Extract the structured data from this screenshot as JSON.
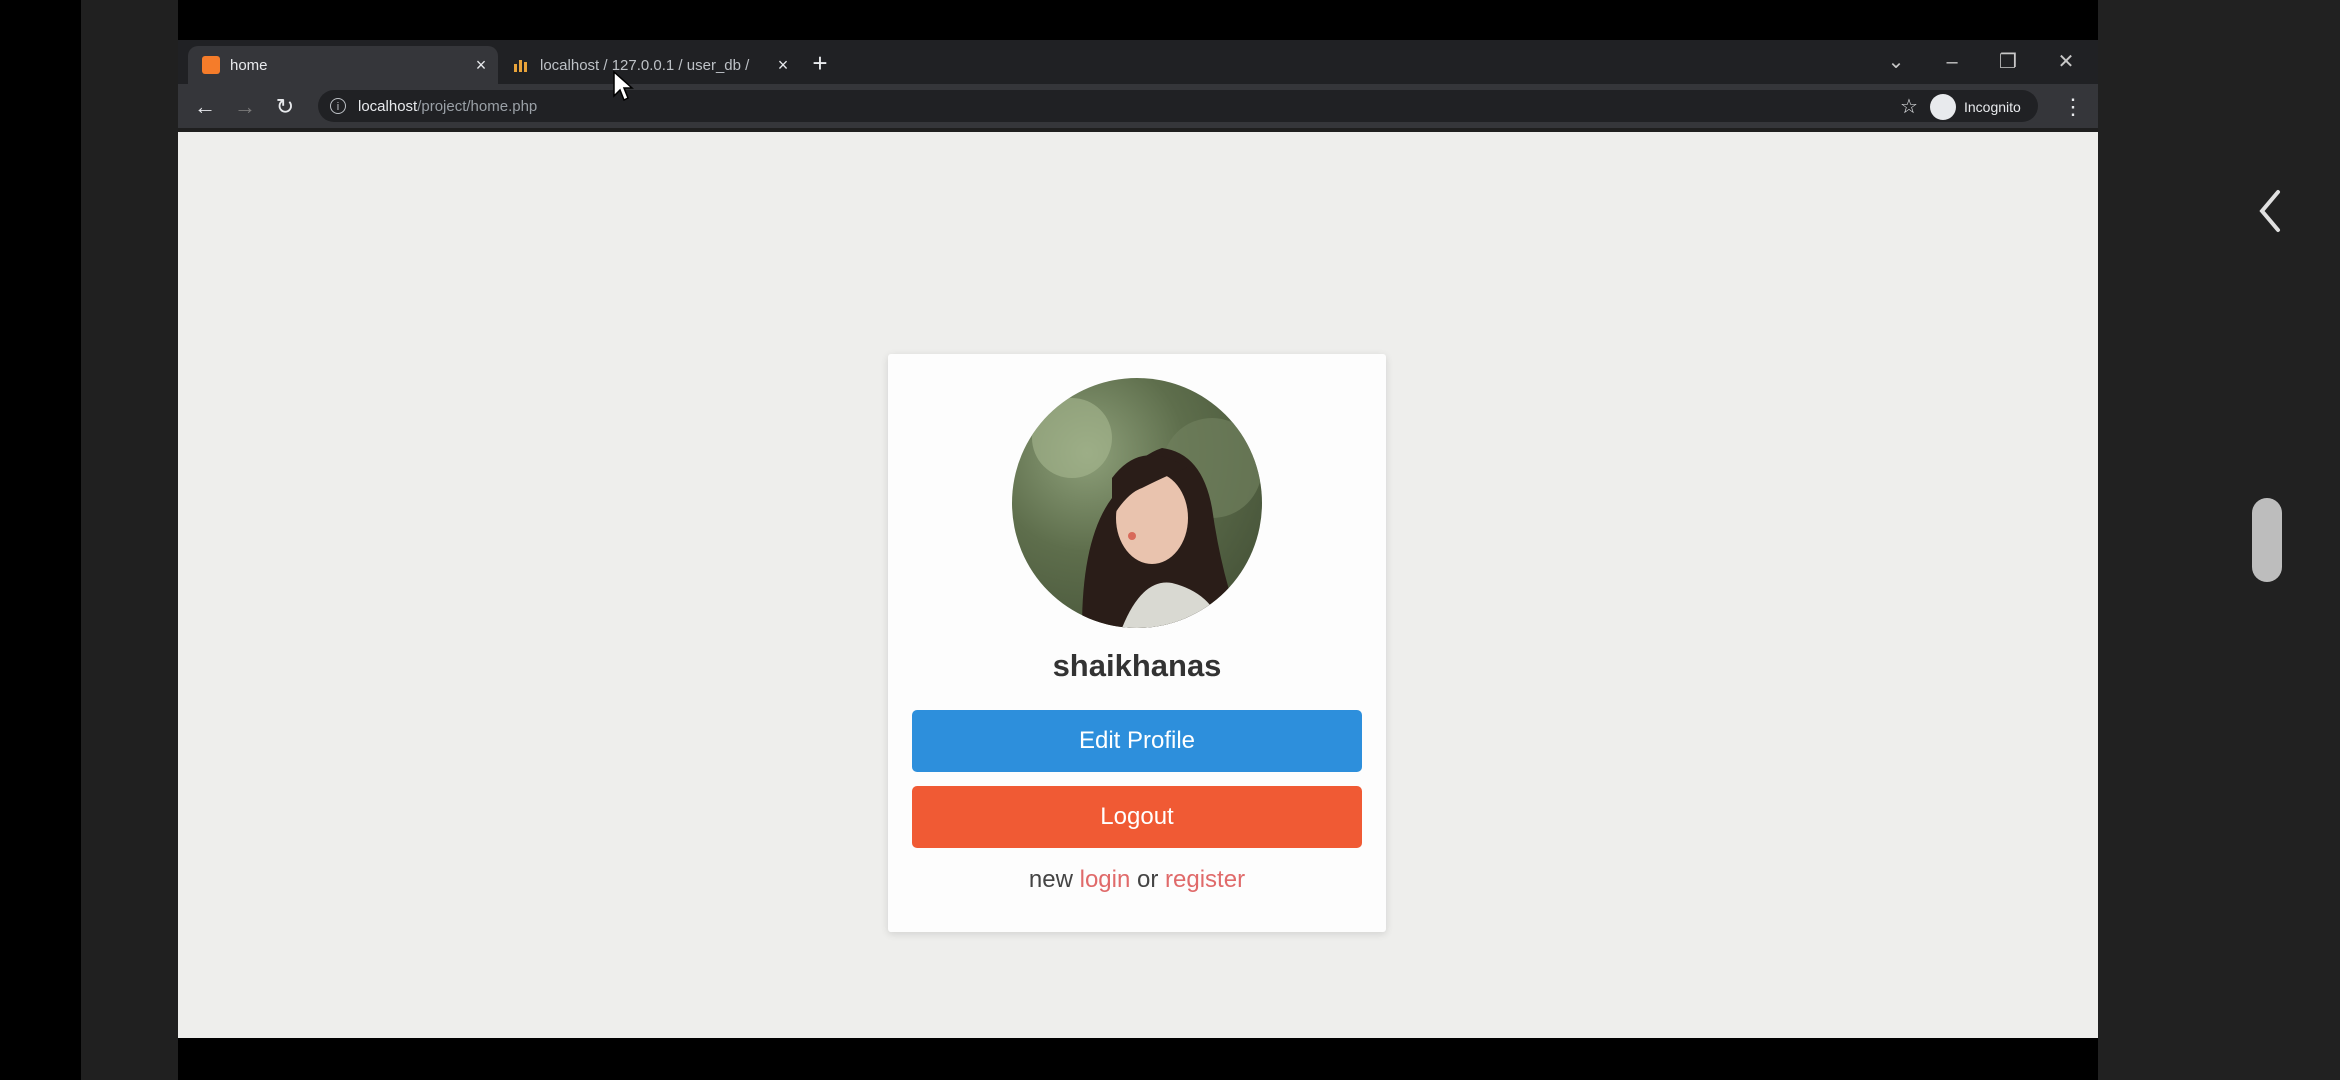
{
  "browser": {
    "tabs": [
      {
        "title": "home",
        "active": true
      },
      {
        "title": "localhost / 127.0.0.1 / user_db /",
        "active": false
      }
    ],
    "new_tab_label": "+",
    "address": {
      "host": "localhost",
      "path": "/project/home.php"
    },
    "profile_label": "Incognito"
  },
  "card": {
    "username": "shaikhanas",
    "edit_label": "Edit Profile",
    "logout_label": "Logout",
    "footer": {
      "prefix": "new",
      "login": "login",
      "middle": "or",
      "register": "register"
    }
  },
  "colors": {
    "edit_button": "#2d8fdc",
    "logout_button": "#f05a34",
    "link": "#e06a6a",
    "page_background": "#eeeeec"
  }
}
